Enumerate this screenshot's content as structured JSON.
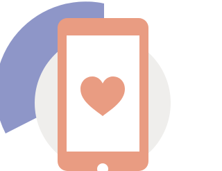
{
  "illustration": {
    "subject": "phone-heart-icon",
    "colors": {
      "background": "#ffffff",
      "arc": "#8e96c8",
      "circle": "#efeeec",
      "phone": "#e99c82",
      "screen": "#ffffff",
      "heart": "#e99c82"
    }
  }
}
